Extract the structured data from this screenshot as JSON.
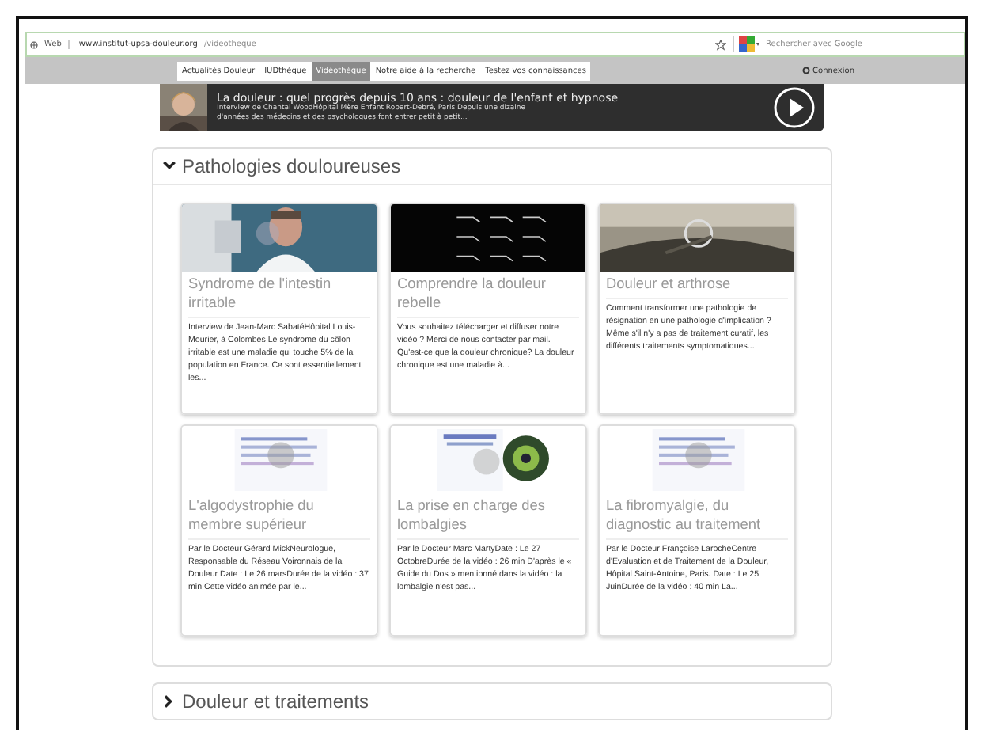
{
  "browser": {
    "site_label": "Web",
    "url_host": "www.institut-upsa-douleur.org",
    "url_path": "/videotheque",
    "search_placeholder": "Rechercher avec Google"
  },
  "nav": {
    "items": [
      {
        "label": "Actualités Douleur",
        "selected": false
      },
      {
        "label": "IUDthèque",
        "selected": false
      },
      {
        "label": "Vidéothèque",
        "selected": true
      },
      {
        "label": "Notre aide à la recherche",
        "selected": false
      },
      {
        "label": "Testez vos connaissances",
        "selected": false
      }
    ],
    "login": "Connexion"
  },
  "featured": {
    "title": "La douleur : quel progrès depuis 10 ans : douleur de l'enfant et hypnose",
    "description": "Interview de Chantal WoodHôpital Mère Enfant Robert-Debré, Paris Depuis une dizaine d'années des médecins et des psychologues font entrer petit à petit..."
  },
  "sections": [
    {
      "title": "Pathologies douloureuses",
      "expanded": true,
      "videos": [
        {
          "title": "Syndrome de l'intestin irritable",
          "summary": "Interview de Jean-Marc SabatéHôpital Louis-Mourier, à Colombes Le syndrome du côlon irritable est une maladie qui touche 5% de la population en France. Ce sont essentiellement les..."
        },
        {
          "title": "Comprendre la douleur rebelle",
          "summary": "Vous souhaitez télécharger et diffuser notre vidéo ? Merci de nous contacter par mail. Qu'est-ce que la douleur chronique?  La douleur chronique est une maladie à..."
        },
        {
          "title": "Douleur et arthrose",
          "summary": "Comment transformer une pathologie de résignation en une pathologie d'implication ?  Même s'il n'y a pas de traitement curatif, les différents traitements symptomatiques..."
        },
        {
          "title": "L'algodystrophie du membre supérieur",
          "summary": "Par le Docteur Gérard MickNeurologue, Responsable du Réseau Voironnais de la Douleur Date : Le 26 marsDurée de la vidéo : 37 min Cette vidéo animée par le..."
        },
        {
          "title": "La prise en charge des lombalgies",
          "summary": "Par le Docteur Marc MartyDate : Le 27 OctobreDurée de la vidéo : 26 min D'après le « Guide du Dos » mentionné dans la vidéo : la lombalgie n'est pas..."
        },
        {
          "title": "La fibromyalgie, du diagnostic au traitement",
          "summary": "Par le Docteur Françoise LarocheCentre d'Evaluation et de Traitement de la Douleur, Hôpital Saint-Antoine, Paris. Date : Le 25 JuinDurée de la vidéo : 40 min La..."
        }
      ]
    },
    {
      "title": "Douleur et traitements",
      "expanded": false
    }
  ]
}
